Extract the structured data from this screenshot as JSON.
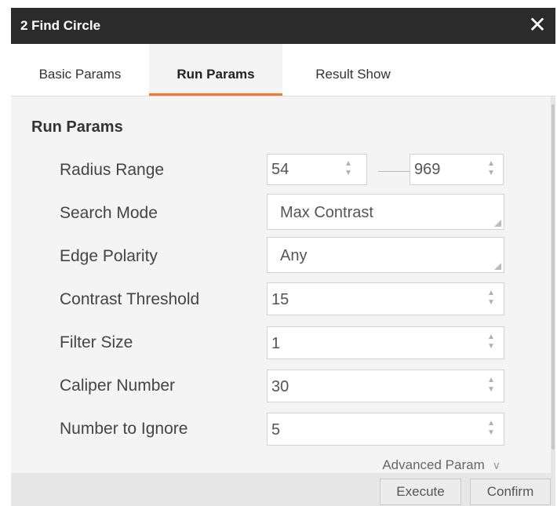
{
  "window": {
    "title": "2 Find Circle",
    "close_symbol": "✕"
  },
  "tabs": [
    {
      "label": "Basic Params",
      "active": false
    },
    {
      "label": "Run Params",
      "active": true
    },
    {
      "label": "Result Show",
      "active": false
    }
  ],
  "section_title": "Run Params",
  "params": {
    "radius_range": {
      "label": "Radius Range",
      "min": "54",
      "max": "969"
    },
    "search_mode": {
      "label": "Search Mode",
      "value": "Max Contrast"
    },
    "edge_polarity": {
      "label": "Edge Polarity",
      "value": "Any"
    },
    "contrast_threshold": {
      "label": "Contrast Threshold",
      "value": "15"
    },
    "filter_size": {
      "label": "Filter Size",
      "value": "1"
    },
    "caliper_number": {
      "label": "Caliper Number",
      "value": "30"
    },
    "number_to_ignore": {
      "label": "Number to Ignore",
      "value": "5"
    }
  },
  "advanced_param": "Advanced Param",
  "buttons": {
    "execute": "Execute",
    "confirm": "Confirm"
  },
  "colors": {
    "titlebar": "#2b2b2b",
    "active_tab_underline": "#f07a25",
    "panel": "#f4f4f4"
  }
}
